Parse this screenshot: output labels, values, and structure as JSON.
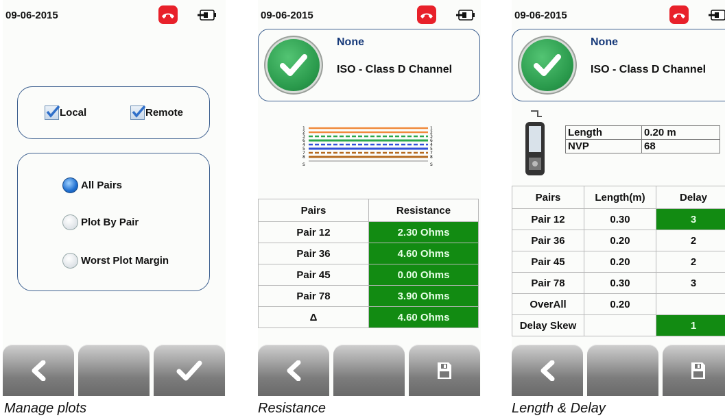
{
  "date": "09-06-2015",
  "icons": {
    "phone": "phone-hangup-icon",
    "battery": "battery-plug-icon",
    "back": "back-chevron-icon",
    "confirm": "checkmark-icon",
    "save": "save-disk-icon",
    "status": "pass-check-icon",
    "tester": "handheld-tester-icon"
  },
  "colors": {
    "pass_green": "#128b12",
    "phone_red": "#e8212a",
    "frame_blue": "#3c5f8f",
    "header_text": "#173a7a"
  },
  "manage_plots": {
    "caption": "Manage plots",
    "local_label": "Local",
    "remote_label": "Remote",
    "local_checked": true,
    "remote_checked": true,
    "options": [
      {
        "label": "All Pairs",
        "selected": true
      },
      {
        "label": "Plot By Pair",
        "selected": false
      },
      {
        "label": "Worst Plot Margin",
        "selected": false
      }
    ]
  },
  "resistance": {
    "caption": "Resistance",
    "result": "None",
    "standard": "ISO - Class D Channel",
    "wiremap_pins": [
      "1",
      "2",
      "3",
      "6",
      "4",
      "5",
      "7",
      "8"
    ],
    "shield_label": "S",
    "headers": {
      "pairs": "Pairs",
      "resistance": "Resistance"
    },
    "rows": [
      {
        "pair": "Pair 12",
        "value": "2.30 Ohms"
      },
      {
        "pair": "Pair 36",
        "value": "4.60 Ohms"
      },
      {
        "pair": "Pair 45",
        "value": "0.00 Ohms"
      },
      {
        "pair": "Pair 78",
        "value": "3.90 Ohms"
      },
      {
        "pair": "Δ",
        "value": "4.60 Ohms"
      }
    ]
  },
  "length_delay": {
    "caption": "Length & Delay",
    "result": "None",
    "standard": "ISO - Class D Channel",
    "length_label": "Length",
    "length_value": "0.20 m",
    "nvp_label": "NVP",
    "nvp_value": "68",
    "headers": {
      "pairs": "Pairs",
      "length": "Length(m)",
      "delay": "Delay"
    },
    "rows": [
      {
        "pair": "Pair 12",
        "length": "0.30",
        "delay": "3"
      },
      {
        "pair": "Pair 36",
        "length": "0.20",
        "delay": "2"
      },
      {
        "pair": "Pair 45",
        "length": "0.20",
        "delay": "2"
      },
      {
        "pair": "Pair 78",
        "length": "0.30",
        "delay": "3"
      },
      {
        "pair": "OverAll",
        "length": "0.20",
        "delay": ""
      },
      {
        "pair": "Delay Skew",
        "length": "",
        "delay": "1"
      }
    ]
  }
}
